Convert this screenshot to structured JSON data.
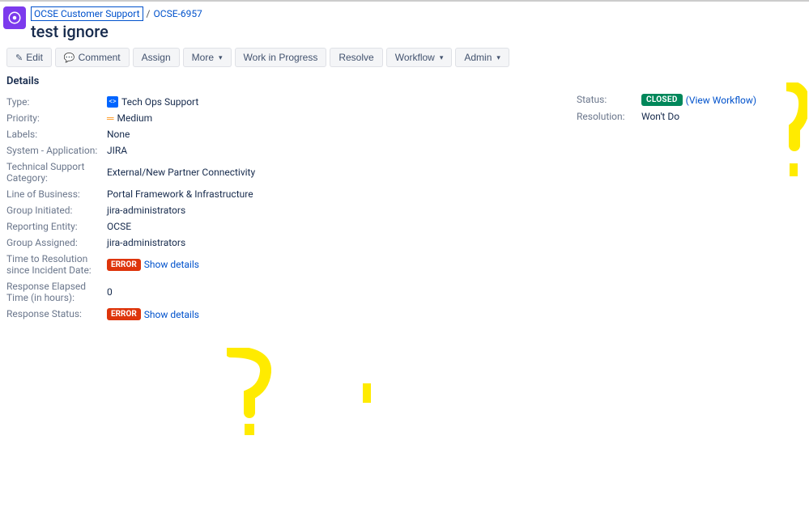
{
  "breadcrumb": {
    "project": "OCSE Customer Support",
    "issue_key": "OCSE-6957"
  },
  "issue_title": "test ignore",
  "toolbar": {
    "edit": "Edit",
    "comment": "Comment",
    "assign": "Assign",
    "more": "More",
    "work_in_progress": "Work in Progress",
    "resolve": "Resolve",
    "workflow": "Workflow",
    "admin": "Admin"
  },
  "details_title": "Details",
  "details": {
    "type": {
      "label": "Type:",
      "value": "Tech Ops Support"
    },
    "priority": {
      "label": "Priority:",
      "value": "Medium"
    },
    "labels": {
      "label": "Labels:",
      "value": "None"
    },
    "system_application": {
      "label": "System - Application:",
      "value": "JIRA"
    },
    "tech_support_category": {
      "label": "Technical Support Category:",
      "value": "External/New Partner Connectivity"
    },
    "line_of_business": {
      "label": "Line of Business:",
      "value": "Portal Framework & Infrastructure"
    },
    "group_initiated": {
      "label": "Group Initiated:",
      "value": "jira-administrators"
    },
    "reporting_entity": {
      "label": "Reporting Entity:",
      "value": "OCSE"
    },
    "group_assigned": {
      "label": "Group Assigned:",
      "value": "jira-administrators"
    },
    "time_to_resolution": {
      "label": "Time to Resolution since Incident Date:",
      "badge": "ERROR",
      "link": "Show details"
    },
    "response_elapsed": {
      "label": "Response Elapsed Time (in hours):",
      "value": "0"
    },
    "response_status": {
      "label": "Response Status:",
      "badge": "ERROR",
      "link": "Show details"
    }
  },
  "right": {
    "status": {
      "label": "Status:",
      "badge": "CLOSED",
      "link": "(View Workflow)"
    },
    "resolution": {
      "label": "Resolution:",
      "value": "Won't Do"
    }
  }
}
